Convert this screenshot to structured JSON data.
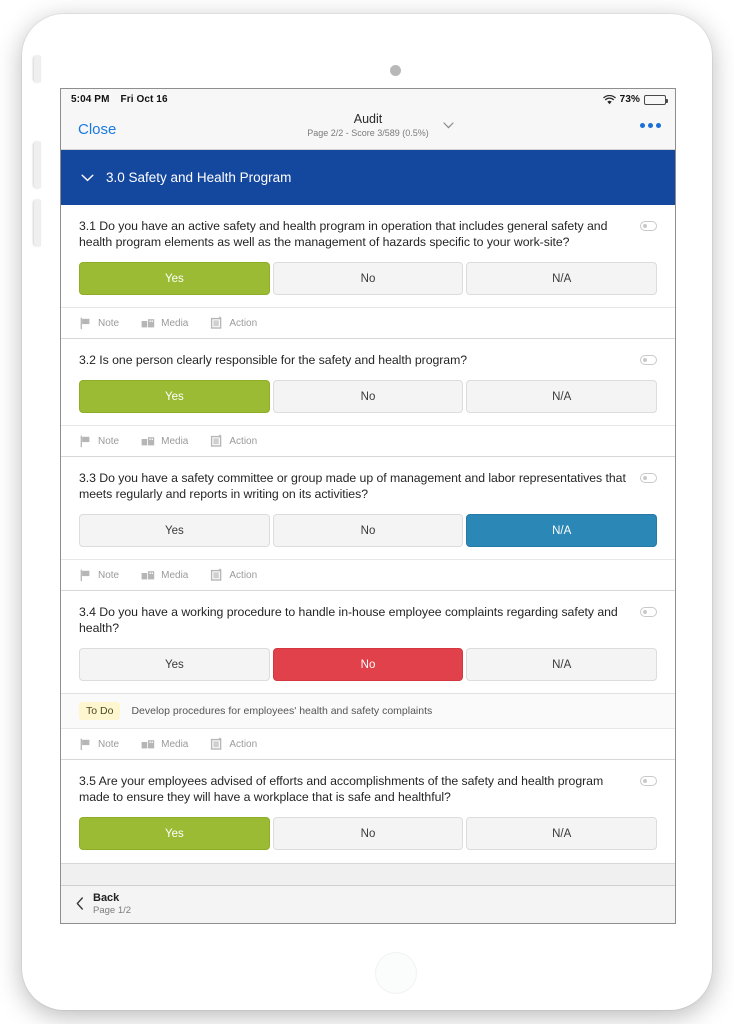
{
  "status_bar": {
    "time": "5:04 PM",
    "date": "Fri Oct 16",
    "battery_percent": "73%",
    "wifi_icon": "wifi-icon",
    "battery_icon": "battery-icon"
  },
  "nav": {
    "close_label": "Close",
    "title": "Audit",
    "subtitle": "Page 2/2 - Score 3/589 (0.5%)",
    "chevron_icon": "chevron-down-icon",
    "more_icon": "more-options-icon"
  },
  "section": {
    "chevron_icon": "chevron-down-icon",
    "title": "3.0 Safety and Health Program",
    "color": "#14479e"
  },
  "colors": {
    "yes_selected": "#9cbb34",
    "no_selected": "#e0414a",
    "na_selected": "#2b87b5",
    "section_blue": "#14479e",
    "link_blue": "#1b7ae0",
    "todo_badge_bg": "#fdf6cf"
  },
  "meta_actions": [
    {
      "label": "Note",
      "icon": "flag-icon"
    },
    {
      "label": "Media",
      "icon": "image-icon"
    },
    {
      "label": "Action",
      "icon": "clipboard-icon"
    }
  ],
  "answer_options": {
    "yes": "Yes",
    "no": "No",
    "na": "N/A"
  },
  "questions": [
    {
      "text": "3.1 Do you have an active safety and health program in operation that includes general safety and health program elements as well as the management of hazards specific to your work-site?",
      "selected": "yes",
      "todo": null
    },
    {
      "text": "3.2 Is one person clearly responsible for the safety and health program?",
      "selected": "yes",
      "todo": null
    },
    {
      "text": "3.3 Do you have a safety committee or group made up of management and labor representatives that meets regularly and reports in writing on its activities?",
      "selected": "na",
      "todo": null
    },
    {
      "text": "3.4 Do you have a working procedure to handle in-house employee complaints regarding safety and health?",
      "selected": "no",
      "todo": {
        "badge": "To Do",
        "text": "Develop procedures for employees' health and safety complaints"
      }
    },
    {
      "text": "3.5 Are your employees advised of efforts and accomplishments of the safety and health program made to ensure they will have a workplace that is safe and healthful?",
      "selected": "yes",
      "todo": null
    }
  ],
  "footer": {
    "back_label": "Back",
    "page_label": "Page 1/2",
    "chevron_icon": "chevron-left-icon"
  }
}
